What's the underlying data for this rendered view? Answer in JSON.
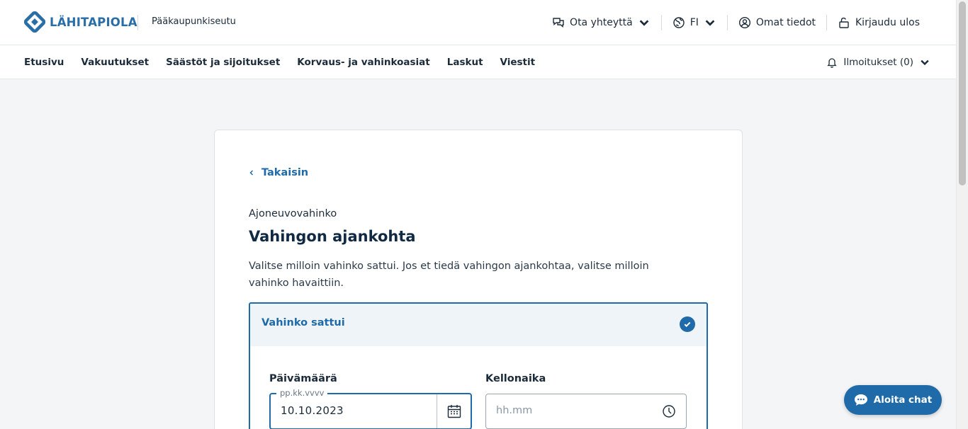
{
  "header": {
    "logo_text": "LÄHITAPIOLA",
    "region": "Pääkaupunkiseutu",
    "contact": "Ota yhteyttä",
    "language": "FI",
    "profile": "Omat tiedot",
    "logout": "Kirjaudu ulos"
  },
  "nav": {
    "items": [
      {
        "label": "Etusivu"
      },
      {
        "label": "Vakuutukset"
      },
      {
        "label": "Säästöt ja sijoitukset"
      },
      {
        "label": "Korvaus- ja vahinkoasiat"
      },
      {
        "label": "Laskut"
      },
      {
        "label": "Viestit"
      }
    ],
    "notifications": "Ilmoitukset (0)"
  },
  "form": {
    "back": "Takaisin",
    "overline": "Ajoneuvovahinko",
    "title": "Vahingon ajankohta",
    "description": "Valitse milloin vahinko sattui. Jos et tiedä vahingon ajankohtaa, valitse milloin vahinko havaittiin.",
    "option_label": "Vahinko sattui",
    "option_selected": true,
    "date_label": "Päivämäärä",
    "date_format_hint": "pp.kk.vvvv",
    "date_value": "10.10.2023",
    "time_label": "Kellonaika",
    "time_placeholder": "hh.mm"
  },
  "chat": {
    "label": "Aloita chat"
  },
  "colors": {
    "brand": "#1f6aa8",
    "text": "#1c2b3a",
    "background": "#f3f5f7"
  },
  "icons": {
    "contact": "chat-bubbles-icon",
    "language": "globe-icon",
    "profile": "user-circle-icon",
    "logout": "logout-icon",
    "notifications": "bell-icon",
    "date": "calendar-icon",
    "time": "clock-icon",
    "selected": "check-circle-icon"
  }
}
